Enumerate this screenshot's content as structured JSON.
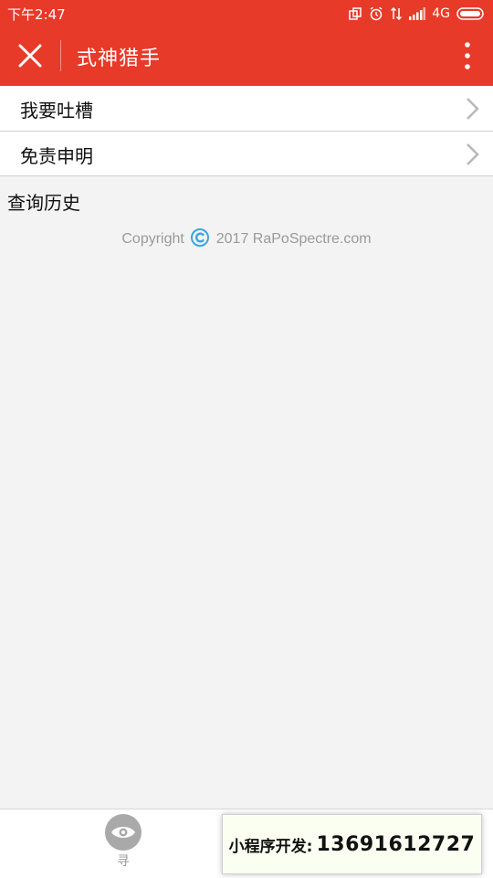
{
  "status_bar": {
    "time": "下午2:47",
    "network": "4G"
  },
  "title_bar": {
    "title": "式神猎手",
    "close_icon": "close-icon",
    "more_icon": "more-vertical-icon"
  },
  "menu": {
    "items": [
      {
        "label": "我要吐槽"
      },
      {
        "label": "免责申明"
      }
    ]
  },
  "history": {
    "title": "查询历史"
  },
  "footer": {
    "copyright_prefix": "Copyright",
    "copyright_suffix": "2017 RaPoSpectre.com"
  },
  "tabbar": {
    "seek_label": "寻"
  },
  "promo": {
    "label": "小程序开发:",
    "phone": "13691612727"
  },
  "colors": {
    "brand": "#e83a28",
    "background": "#f3f3f3",
    "copyright_icon": "#3aa6df"
  }
}
